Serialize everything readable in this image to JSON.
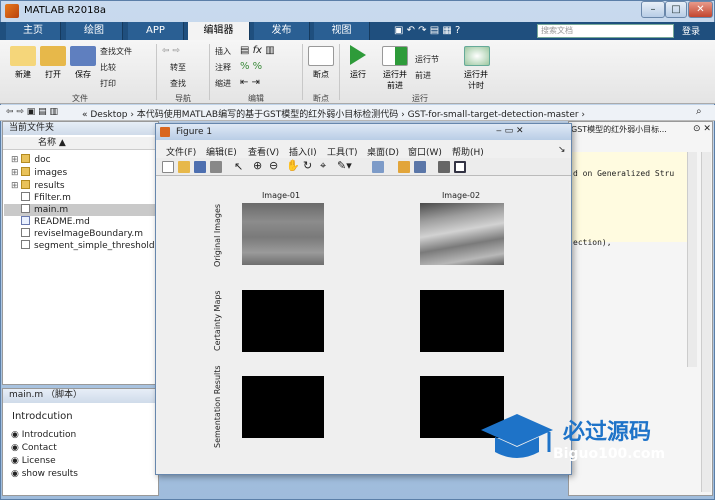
{
  "window": {
    "title": "MATLAB R2018a"
  },
  "tabs": [
    "主页",
    "绘图",
    "APP",
    "编辑器",
    "发布",
    "视图"
  ],
  "search": {
    "placeholder": "搜索文档"
  },
  "login": "登录",
  "ribbon": {
    "file_buttons": [
      "新建",
      "打开",
      "保存"
    ],
    "file_small": [
      "查找文件",
      "比较",
      "打印"
    ],
    "nav_small": [
      "转至",
      "查找"
    ],
    "edit_small": [
      "插入",
      "注释",
      "缩进"
    ],
    "breakpoint": "断点",
    "run_buttons": [
      "运行",
      "运行并\n前进",
      "运行节",
      "前进",
      "运行并\n计时"
    ],
    "groups": [
      "文件",
      "导航",
      "编辑",
      "断点",
      "运行"
    ]
  },
  "address": {
    "path": "« Desktop › 本代码使用MATLAB编写的基于GST模型的红外弱小目标检测代码 › GST-for-small-target-detection-master ›"
  },
  "file_panel": {
    "title": "当前文件夹",
    "column": "名称 ▲",
    "items": [
      {
        "name": "doc",
        "type": "folder"
      },
      {
        "name": "images",
        "type": "folder"
      },
      {
        "name": "results",
        "type": "folder"
      },
      {
        "name": "Ffilter.m",
        "type": "m"
      },
      {
        "name": "main.m",
        "type": "m",
        "selected": true
      },
      {
        "name": "README.md",
        "type": "md"
      },
      {
        "name": "reviseImageBoundary.m",
        "type": "m"
      },
      {
        "name": "segment_simple_threshold.m",
        "type": "m"
      }
    ]
  },
  "details": {
    "title": "main.m （脚本）",
    "heading": "Introdcution",
    "items": [
      "Introdcution",
      "Contact",
      "License",
      "show results"
    ]
  },
  "editor_snippet": {
    "tab_text": "GST模型的红外弱小目标...",
    "line1": "d on  Generalized Stru",
    "line2": "ection),"
  },
  "figure": {
    "title": "Figure 1",
    "menu": [
      "文件(F)",
      "编辑(E)",
      "查看(V)",
      "插入(I)",
      "工具(T)",
      "桌面(D)",
      "窗口(W)",
      "帮助(H)"
    ],
    "columns": [
      "Image-01",
      "Image-02"
    ],
    "rows": [
      "Original Images",
      "Certainty Maps",
      "Sementation Results"
    ]
  },
  "watermark": {
    "text": "必过源码",
    "url": "Biguo100.com"
  }
}
